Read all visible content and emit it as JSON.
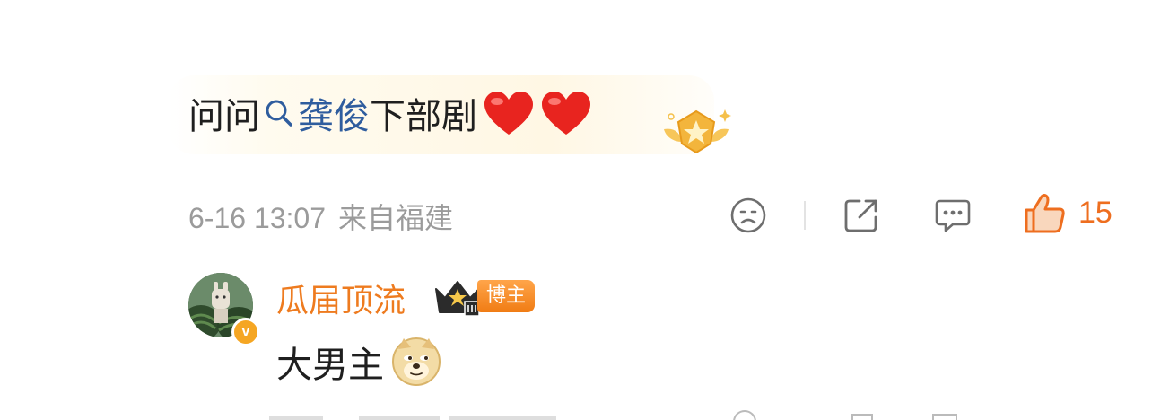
{
  "comment": {
    "prefix": "问问",
    "topic": "龚俊",
    "suffix": "下部剧",
    "emoji": [
      "heart-emoji",
      "heart-emoji"
    ],
    "medal_icon": "star-medal-icon"
  },
  "meta": {
    "timestamp": "6-16 13:07",
    "location": "来自福建",
    "like_count": "15"
  },
  "actions": [
    "dislike-face-icon",
    "share-icon",
    "reply-icon",
    "like-thumb-icon"
  ],
  "reply": {
    "username": "瓜届顶流",
    "tag": "博主",
    "text": "大男主",
    "emoji": "doge-emoji",
    "badge": "v",
    "crown_icon": "crown-level-icon"
  },
  "colors": {
    "accent_orange": "#ee7b1f",
    "link_blue": "#2f5d9e",
    "meta_gray": "#9b9b9b"
  }
}
